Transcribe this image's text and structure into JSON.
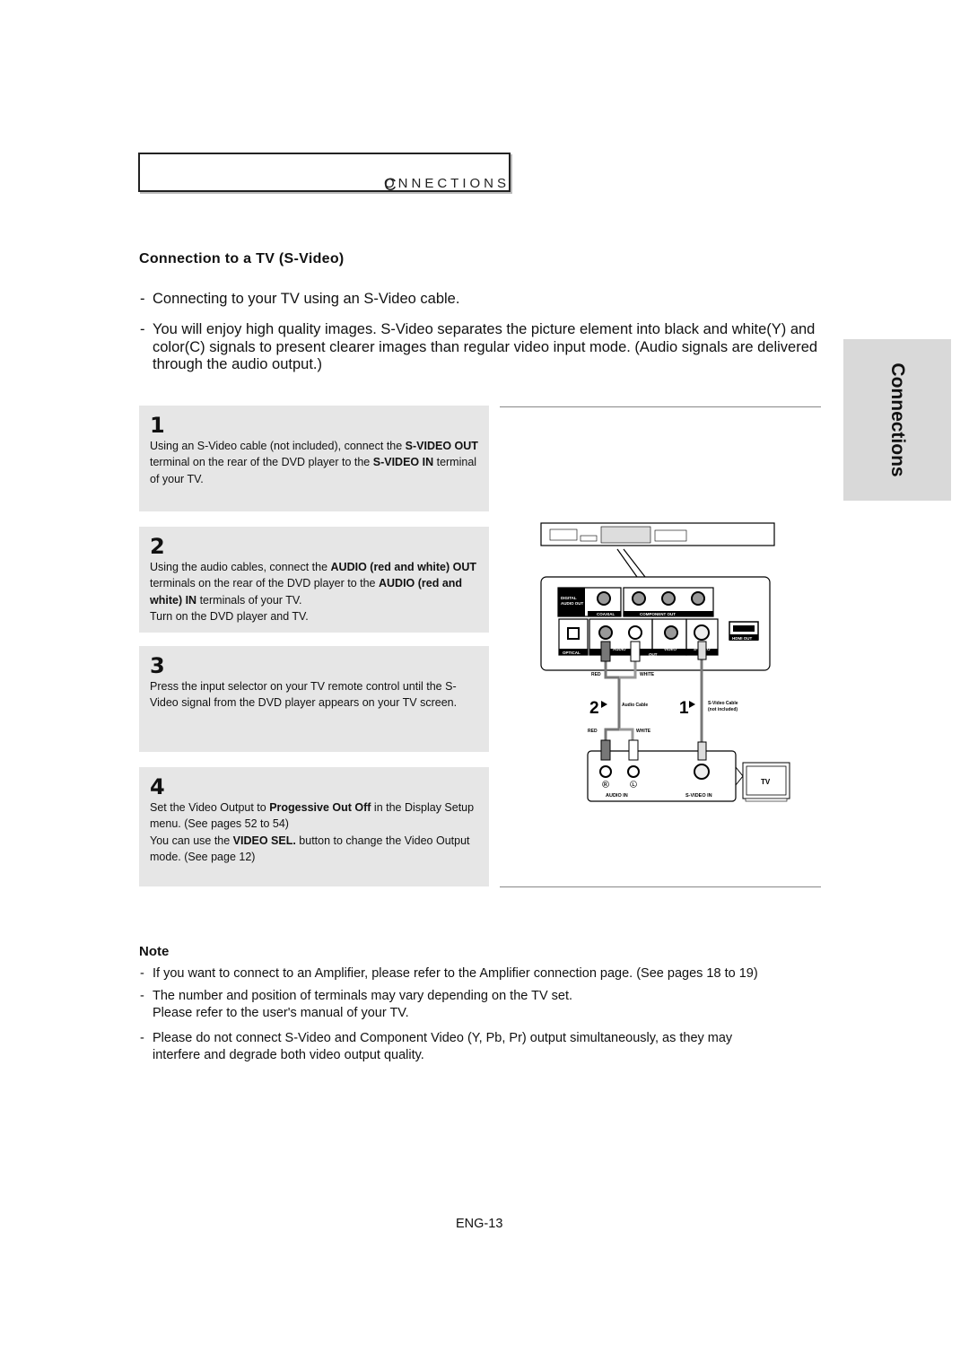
{
  "header": {
    "first_letter": "C",
    "rest": "ONNECTIONS"
  },
  "section_title": "Connection to a TV (S-Video)",
  "intro": [
    "Connecting to your TV using an S-Video cable.",
    "You will enjoy high quality images. S-Video separates the picture element into black and white(Y) and color(C) signals to present clearer images than regular video input mode. (Audio signals are delivered through the audio output.)"
  ],
  "side_tab": "Connections",
  "steps": [
    {
      "number": "1",
      "segments": [
        {
          "t": "Using an S-Video cable (not included), connect the ",
          "b": false
        },
        {
          "t": "S-VIDEO OUT",
          "b": true
        },
        {
          "t": " terminal on the rear of the DVD player to the ",
          "b": false
        },
        {
          "t": "S-VIDEO IN",
          "b": true
        },
        {
          "t": " terminal of your TV.",
          "b": false
        }
      ]
    },
    {
      "number": "2",
      "segments": [
        {
          "t": "Using the audio cables, connect the ",
          "b": false
        },
        {
          "t": "AUDIO (red and white) OUT",
          "b": true
        },
        {
          "t": " terminals on the rear of the DVD player to the ",
          "b": false
        },
        {
          "t": "AUDIO (red and white) IN",
          "b": true
        },
        {
          "t": " terminals of your TV.",
          "b": false
        }
      ],
      "extra": "Turn on the DVD player and TV."
    },
    {
      "number": "3",
      "segments": [
        {
          "t": "Press the input selector on your TV remote control until the S-Video signal from the DVD player appears on your TV screen.",
          "b": false
        }
      ]
    },
    {
      "number": "4",
      "segments": [
        {
          "t": "Set the Video Output to ",
          "b": false
        },
        {
          "t": "Progessive Out Off",
          "b": true
        },
        {
          "t": " in the Display Setup menu. (See pages 52 to 54)",
          "b": false
        }
      ],
      "extra_segments": [
        {
          "t": "You can use the ",
          "b": false
        },
        {
          "t": "VIDEO SEL.",
          "b": true
        },
        {
          "t": " button to change the Video Output mode. (See page 12)",
          "b": false
        }
      ]
    }
  ],
  "diagram": {
    "digital_audio_out": [
      "DIGITAL",
      "AUDIO OUT"
    ],
    "coaxial": "COAXIAL",
    "component_out": "COMPONENT OUT",
    "optical": "OPTICAL",
    "audio": "AUDIO",
    "video": "VIDEO",
    "s_video": "S-VIDEO",
    "out": "OUT",
    "hdmi_out": "HDMI OUT",
    "red": "RED",
    "white": "WHITE",
    "step2": "2",
    "audio_cable": "Audio Cable",
    "step1": "1",
    "s_video_cable": "S-Video Cable",
    "not_included": "(not included)",
    "r": "R",
    "l": "L",
    "audio_in": "AUDIO IN",
    "s_video_in": "S-VIDEO IN",
    "tv": "TV"
  },
  "note": {
    "title": "Note",
    "items": [
      [
        "If you want to connect to an Amplifier, please refer to the Amplifier connection page. (See pages 18 to 19)"
      ],
      [
        "The number and position of terminals may vary depending on the TV set.",
        "Please refer to the user's manual of your TV."
      ],
      [
        "Please do not connect  S-Video and Component Video (Y, Pb, Pr) output simultaneously, as they may interfere and degrade both video output quality."
      ]
    ]
  },
  "page_number": "ENG-13"
}
